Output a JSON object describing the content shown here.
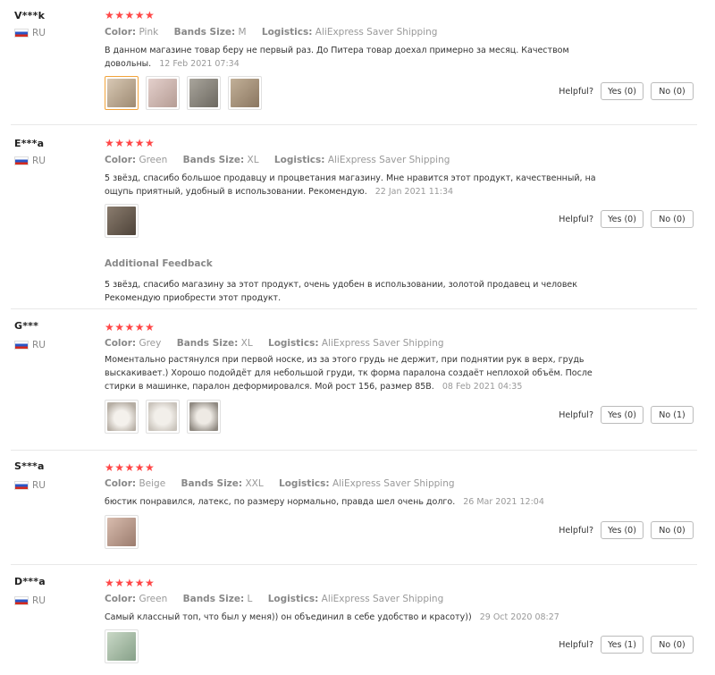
{
  "labels": {
    "color": "Color:",
    "bands_size": "Bands Size:",
    "logistics": "Logistics:",
    "helpful": "Helpful?",
    "additional_feedback": "Additional Feedback",
    "stars": "★★★★★"
  },
  "reviews": [
    {
      "user": "V***k",
      "country": "RU",
      "color": "Pink",
      "size": "M",
      "logistics": "AliExpress Saver Shipping",
      "text": "В данном магазине товар беру не первый раз. До Питера товар доехал примерно за месяц. Качеством довольны.",
      "date": "12 Feb 2021 07:34",
      "yes": "Yes (0)",
      "no": "No (0)",
      "photos": [
        "#b9a48e",
        "#c9b3ad",
        "#8e8a80",
        "#a79780"
      ]
    },
    {
      "user": "E***a",
      "country": "RU",
      "color": "Green",
      "size": "XL",
      "logistics": "AliExpress Saver Shipping",
      "text": "5 звёзд, спасибо большое продавцу и процветания магазину. Мне нравится этот продукт, качественный, на ощупь приятный, удобный в использовании. Рекомендую.",
      "date": "22 Jan 2021 11:34",
      "yes": "Yes (0)",
      "no": "No (0)",
      "photos": [
        "#6e6256"
      ],
      "additional": "5 звёзд, спасибо магазину за этот продукт, очень удобен в использовании, золотой продавец и человек Рекомендую приобрести этот продукт."
    },
    {
      "user": "G***",
      "country": "RU",
      "color": "Grey",
      "size": "XL",
      "logistics": "AliExpress Saver Shipping",
      "text": "Моментально растянулся при первой носке, из за этого грудь не держит, при поднятии рук в верх, грудь выскакивает.) Хорошо подойдёт для небольшой груди, тк форма паралона создаёт неплохой объём. После стирки в машинке, паралон деформировался. Мой рост 156, размер 85В.",
      "date": "08 Feb 2021 04:35",
      "yes": "Yes (0)",
      "no": "No (1)",
      "photos": [
        "#cfc8c0",
        "#d6d2cc",
        "#bdb7b0"
      ]
    },
    {
      "user": "S***a",
      "country": "RU",
      "color": "Beige",
      "size": "XXL",
      "logistics": "AliExpress Saver Shipping",
      "text": "бюстик понравился, латекс, по размеру нормально, правда шел очень долго.",
      "date": "26 Mar 2021 12:04",
      "yes": "Yes (0)",
      "no": "No (0)",
      "photos": [
        "#b89a8a"
      ]
    },
    {
      "user": "D***a",
      "country": "RU",
      "color": "Green",
      "size": "L",
      "logistics": "AliExpress Saver Shipping",
      "text": "Самый классный топ, что был у меня)) он объединил в себе удобство и красоту))",
      "date": "29 Oct 2020 08:27",
      "yes": "Yes (1)",
      "no": "No (0)",
      "photos": [
        "#9fb5a0"
      ]
    }
  ]
}
